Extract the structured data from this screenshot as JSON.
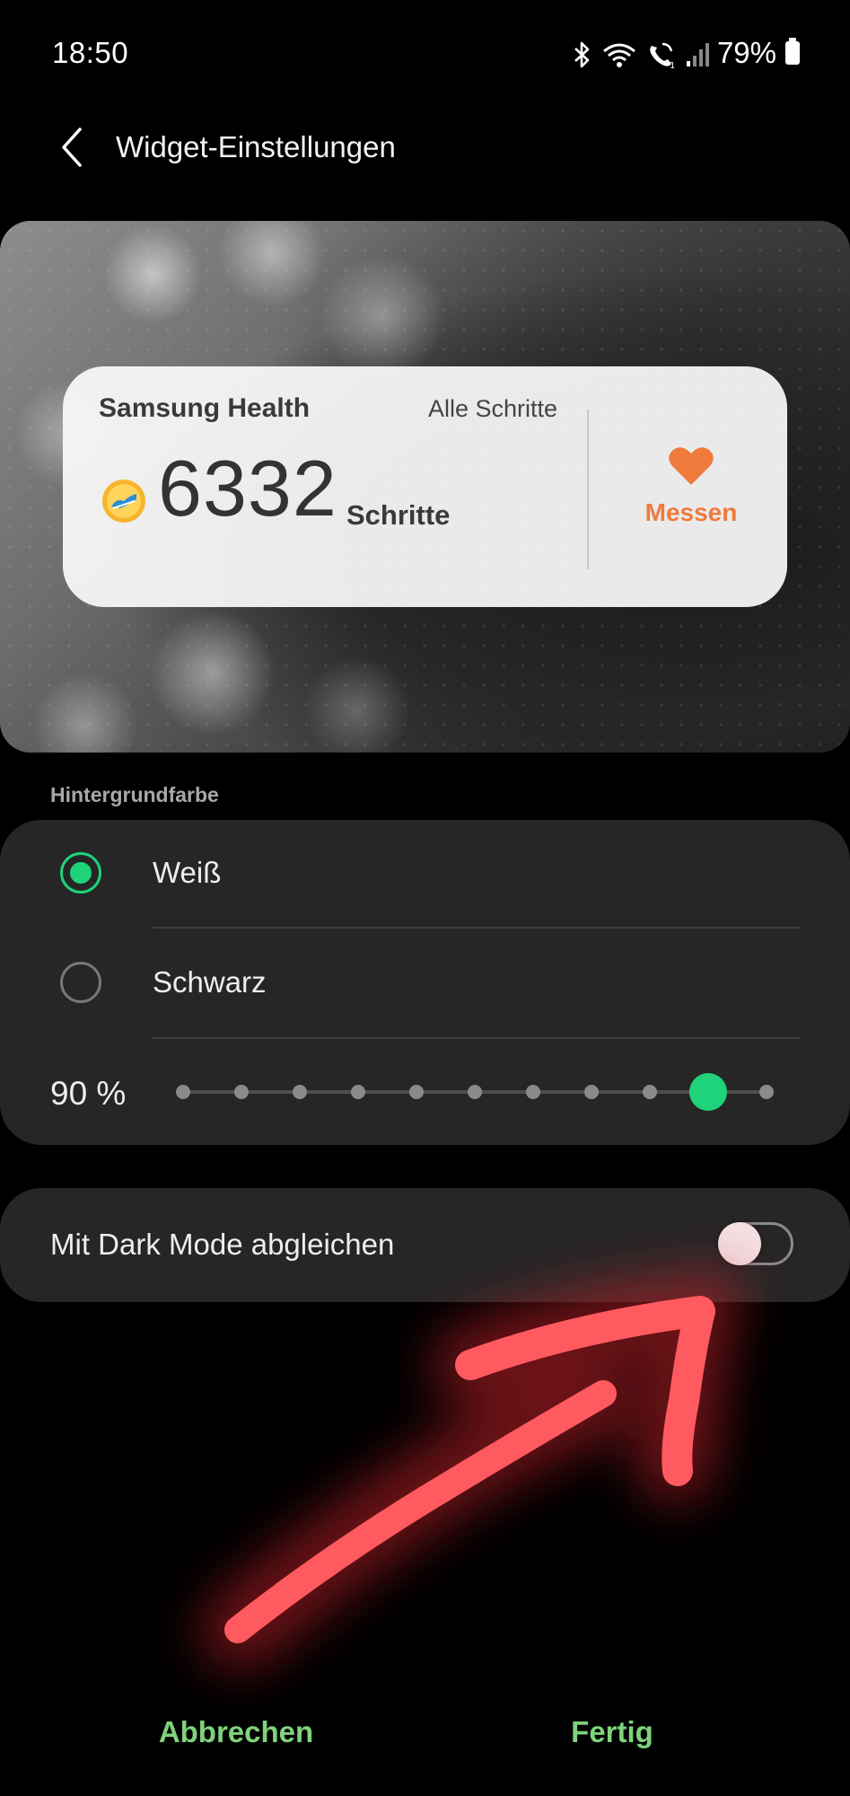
{
  "status_bar": {
    "time": "18:50",
    "battery_percent": "79%",
    "icons": [
      "bluetooth-icon",
      "wifi-icon",
      "wifi-calling-icon",
      "signal-icon",
      "battery-icon"
    ]
  },
  "app_bar": {
    "title": "Widget-Einstellungen",
    "back_icon": "chevron-left-icon"
  },
  "preview": {
    "widget": {
      "app_name": "Samsung Health",
      "filter_label": "Alle Schritte",
      "steps_count": "6332",
      "steps_unit": "Schritte",
      "badge_icon": "running-shoe-badge-icon",
      "measure_icon": "heart-icon",
      "measure_label": "Messen"
    }
  },
  "background_color": {
    "section_label": "Hintergrundfarbe",
    "options": [
      {
        "label": "Weiß",
        "selected": true
      },
      {
        "label": "Schwarz",
        "selected": false
      }
    ],
    "opacity_label": "90 %",
    "opacity_value": 0.9,
    "opacity_steps": 11
  },
  "dark_mode": {
    "label": "Mit Dark Mode abgleichen",
    "enabled": false
  },
  "actions": {
    "cancel_label": "Abbrechen",
    "done_label": "Fertig"
  },
  "colors": {
    "accent_green": "#1ed37a",
    "button_green": "#7fd37a",
    "measure_orange": "#f07a3c",
    "card_background": "#262626",
    "annotation_red": "#ff5a5f"
  }
}
